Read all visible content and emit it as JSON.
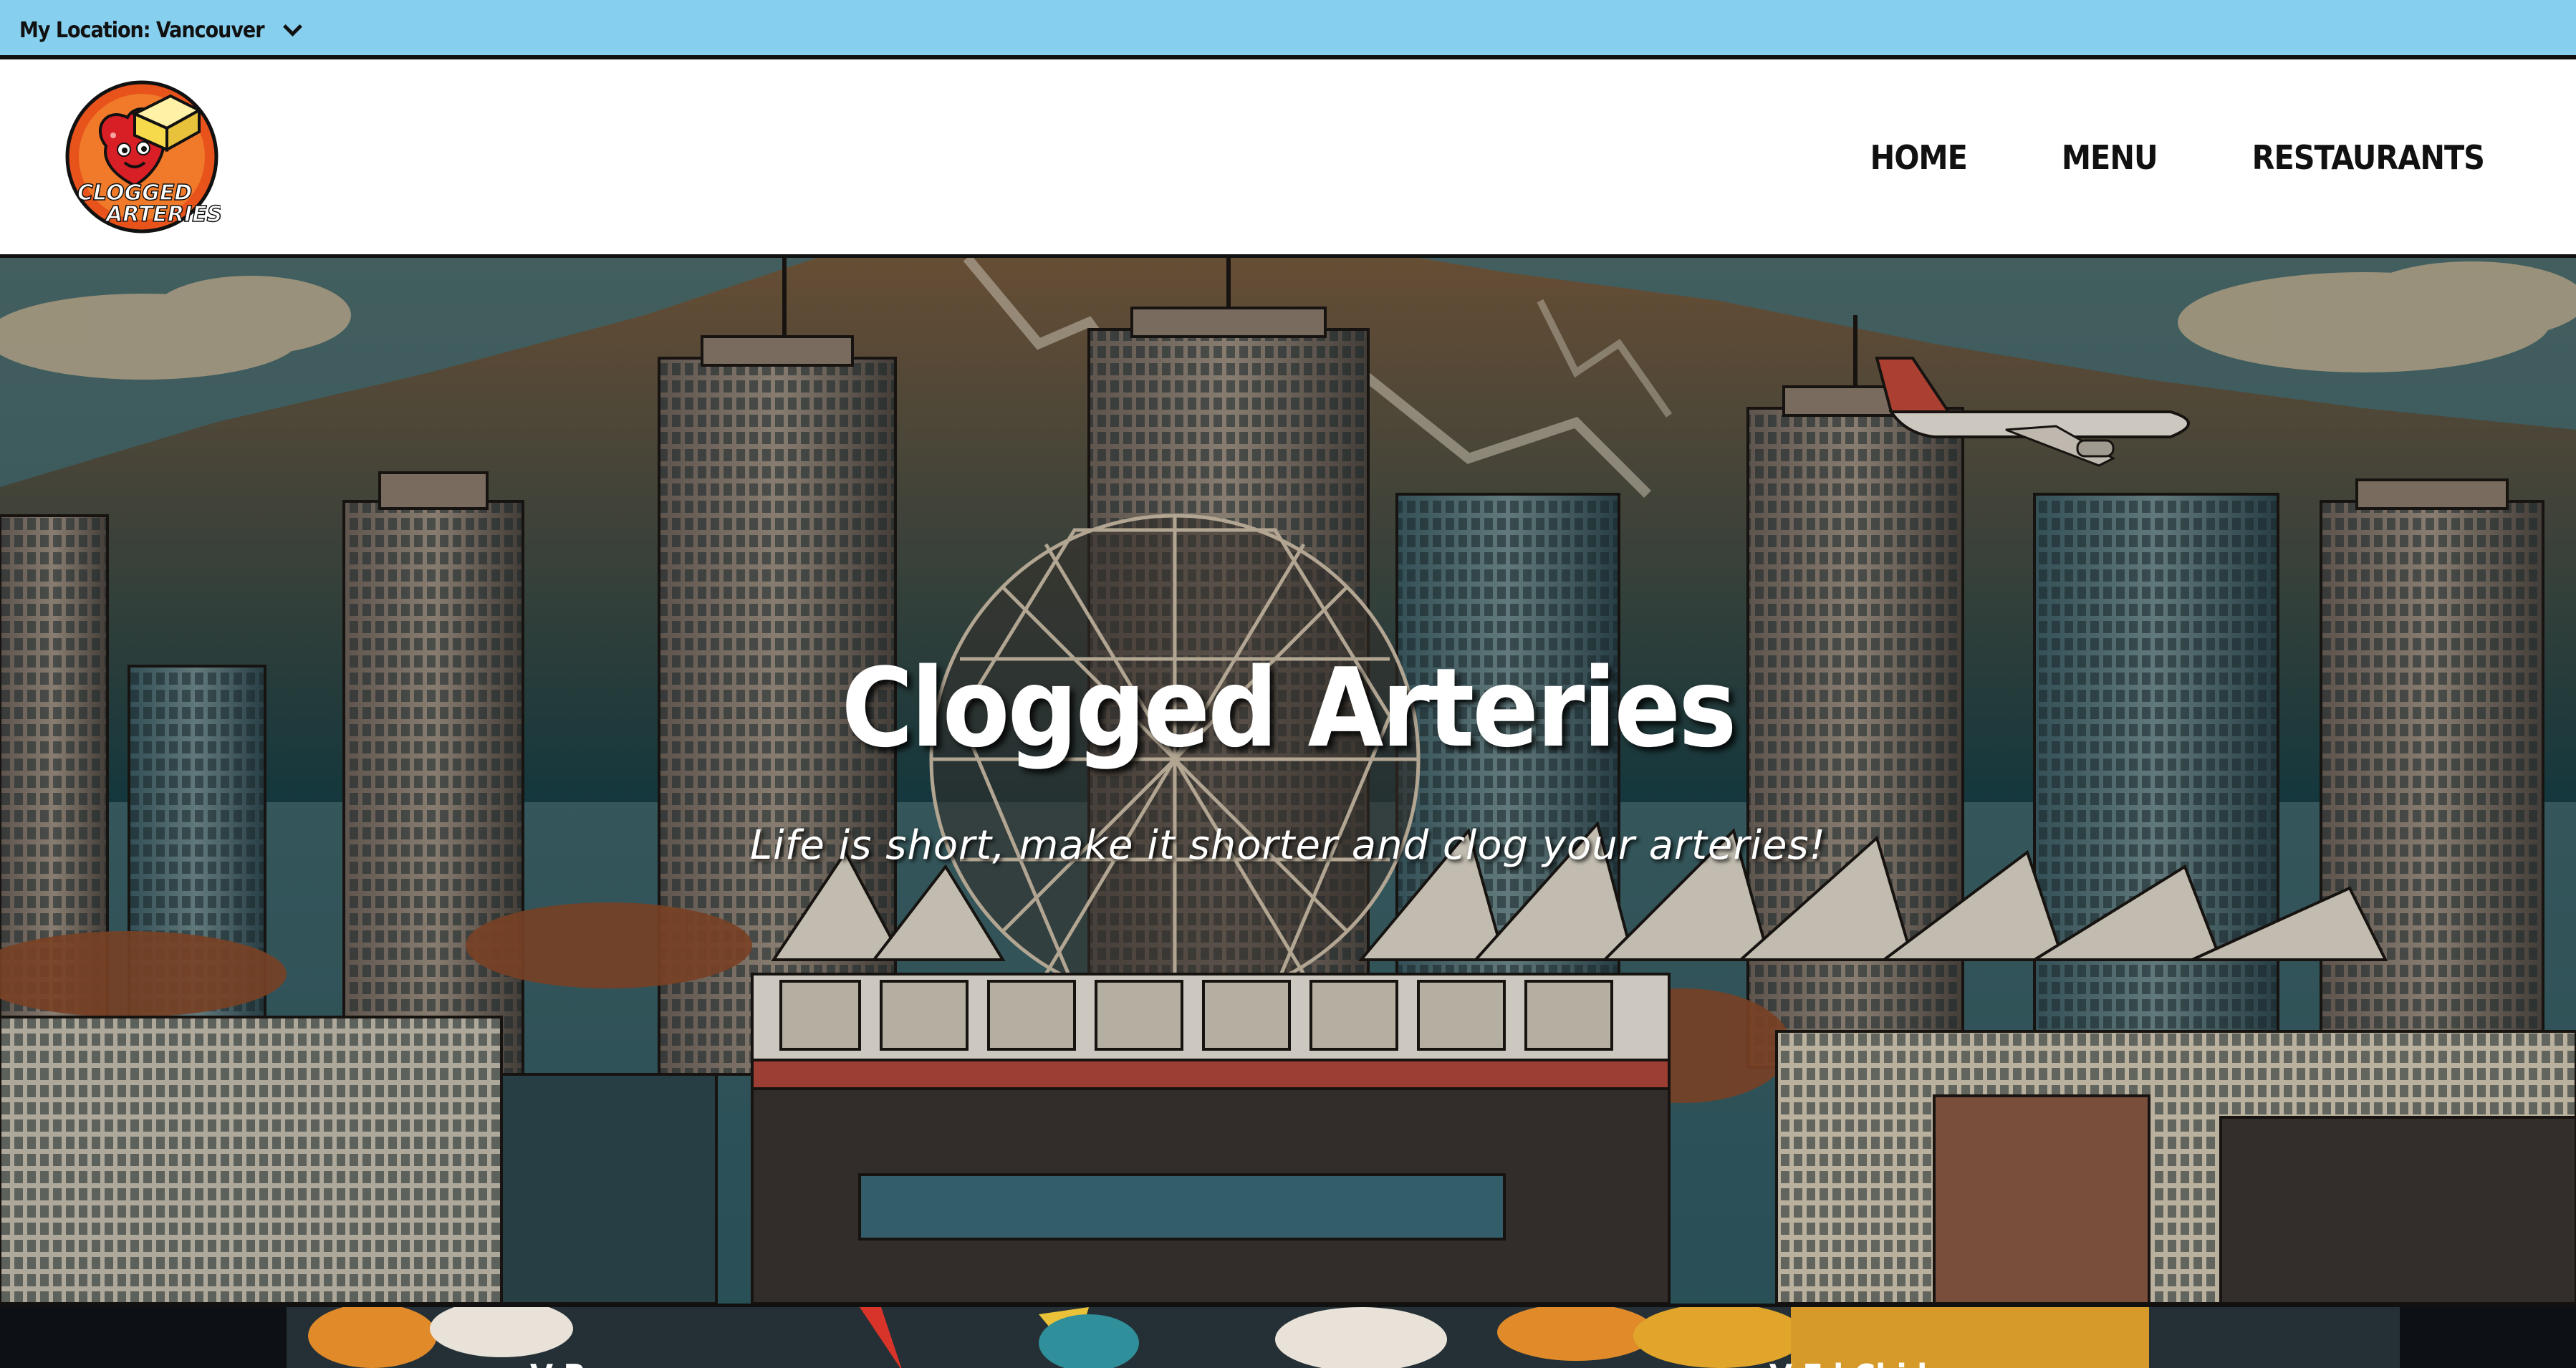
{
  "location_bar": {
    "label": "My Location: Vancouver",
    "bg_color": "#86cfee"
  },
  "logo": {
    "text_line1": "CLOGGED",
    "text_line2": "ARTERIES",
    "icon": "clogged-arteries-mascot-logo"
  },
  "nav": {
    "items": [
      {
        "label": "HOME"
      },
      {
        "label": "MENU"
      },
      {
        "label": "RESTAURANTS"
      }
    ]
  },
  "hero": {
    "title": "Clogged Arteries",
    "tagline": "Life is short, make it shorter and clog your arteries!",
    "image": "vancouver-skyline-comic-illustration"
  },
  "bottom_strip": {
    "left_text": "V         B",
    "right_text": "V         F    l Chi   l"
  }
}
